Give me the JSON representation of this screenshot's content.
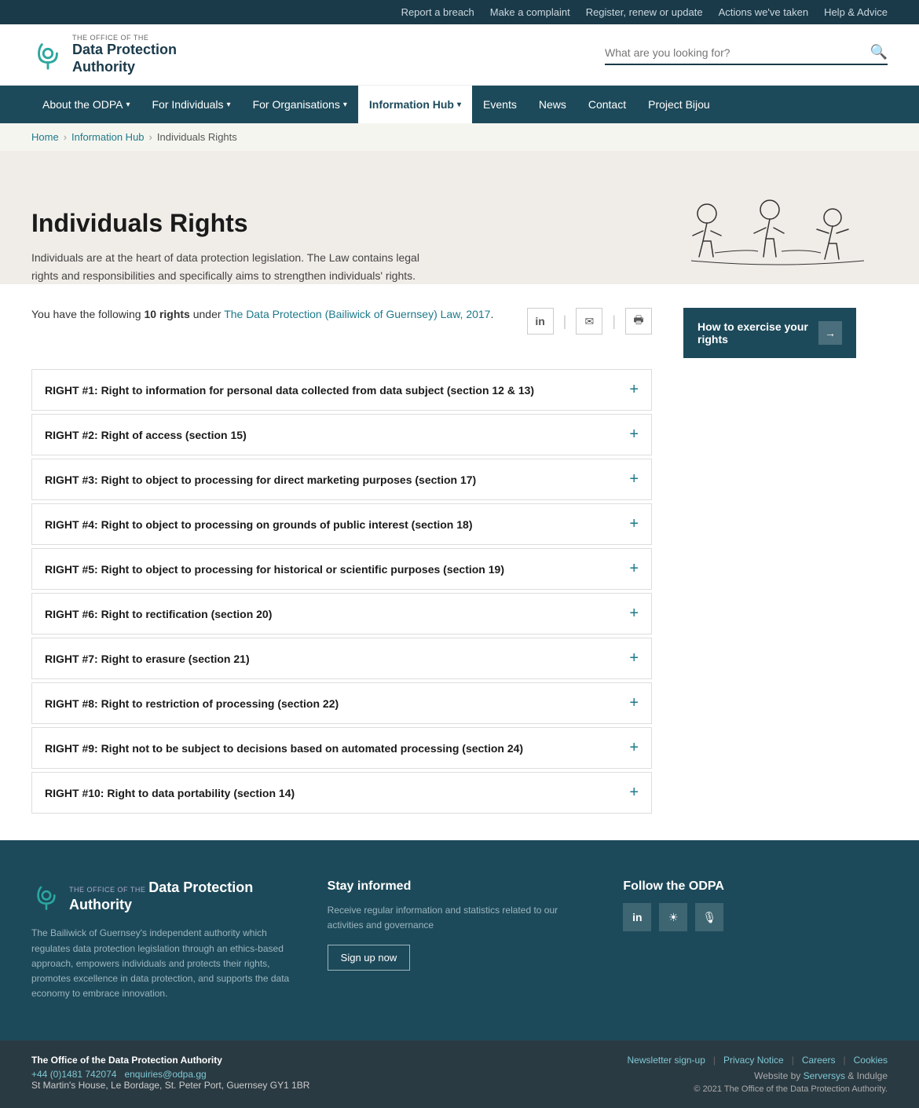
{
  "utility_bar": {
    "links": [
      {
        "id": "report-breach",
        "label": "Report a breach"
      },
      {
        "id": "make-complaint",
        "label": "Make a complaint"
      },
      {
        "id": "register-renew",
        "label": "Register, renew or update"
      },
      {
        "id": "actions-taken",
        "label": "Actions we've taken"
      },
      {
        "id": "help-advice",
        "label": "Help & Advice"
      }
    ]
  },
  "header": {
    "logo_the_office": "THE OFFICE OF THE",
    "logo_name_line1": "Data Protection",
    "logo_name_line2": "Authority",
    "search_placeholder": "What are you looking for?"
  },
  "nav": {
    "items": [
      {
        "id": "about-odpa",
        "label": "About the ODPA",
        "has_dropdown": true
      },
      {
        "id": "for-individuals",
        "label": "For Individuals",
        "has_dropdown": true
      },
      {
        "id": "for-organisations",
        "label": "For Organisations",
        "has_dropdown": true
      },
      {
        "id": "information-hub",
        "label": "Information Hub",
        "has_dropdown": true,
        "active": true
      },
      {
        "id": "events",
        "label": "Events",
        "has_dropdown": false
      },
      {
        "id": "news",
        "label": "News",
        "has_dropdown": false
      },
      {
        "id": "contact",
        "label": "Contact",
        "has_dropdown": false
      },
      {
        "id": "project-bijou",
        "label": "Project Bijou",
        "has_dropdown": false
      }
    ]
  },
  "breadcrumb": {
    "items": [
      {
        "id": "home",
        "label": "Home",
        "link": true
      },
      {
        "id": "information-hub",
        "label": "Information Hub",
        "link": true
      },
      {
        "id": "individuals-rights",
        "label": "Individuals Rights",
        "link": false
      }
    ]
  },
  "hero": {
    "title": "Individuals Rights",
    "description": "Individuals are at the heart of data protection legislation. The Law contains legal rights and responsibilities and specifically aims to strengthen individuals' rights."
  },
  "main": {
    "intro_text_before": "You have the following ",
    "intro_bold": "10 rights",
    "intro_text_after": " under ",
    "intro_link": "The Data Protection (Bailiwick of Guernsey) Law, 2017",
    "intro_end": ".",
    "rights": [
      {
        "id": "right-1",
        "label": "RIGHT #1: Right to information for personal data collected from data subject (section 12 & 13)"
      },
      {
        "id": "right-2",
        "label": "RIGHT #2: Right of access (section 15)"
      },
      {
        "id": "right-3",
        "label": "RIGHT #3: Right to object to processing for direct marketing purposes (section 17)"
      },
      {
        "id": "right-4",
        "label": "RIGHT #4: Right to object to processing on grounds of public interest (section 18)"
      },
      {
        "id": "right-5",
        "label": "RIGHT #5: Right to object to processing for historical or scientific purposes (section 19)"
      },
      {
        "id": "right-6",
        "label": "RIGHT #6: Right to rectification (section 20)"
      },
      {
        "id": "right-7",
        "label": "RIGHT #7: Right to erasure (section 21)"
      },
      {
        "id": "right-8",
        "label": "RIGHT #8: Right to restriction of processing (section 22)"
      },
      {
        "id": "right-9",
        "label": "RIGHT #9: Right not to be subject to decisions based on automated processing (section 24)"
      },
      {
        "id": "right-10",
        "label": "RIGHT #10: Right to data portability (section 14)"
      }
    ],
    "sidebar_cta": "How to exercise your rights"
  },
  "footer": {
    "logo_the_office": "THE OFFICE OF THE",
    "logo_name_line1": "Data Protection",
    "logo_name_line2": "Authority",
    "description": "The Bailiwick of Guernsey's independent authority which regulates data protection legislation through an ethics-based approach, empowers individuals and protects their rights, promotes excellence in data protection, and supports the data economy to embrace innovation.",
    "stay_informed_title": "Stay informed",
    "stay_informed_text": "Receive regular information and statistics related to our activities and governance",
    "sign_up_label": "Sign up now",
    "follow_title": "Follow the ODPA",
    "social_icons": [
      {
        "id": "linkedin",
        "symbol": "in"
      },
      {
        "id": "soundcloud",
        "symbol": "☁"
      },
      {
        "id": "podcast",
        "symbol": "🎙"
      }
    ],
    "bottom": {
      "org_name": "The Office of the Data Protection Authority",
      "phone": "+44 (0)1481 742074",
      "email": "enquiries@odpa.gg",
      "address": "St Martin's House, Le Bordage, St. Peter Port, Guernsey GY1 1BR",
      "links": [
        {
          "id": "newsletter-signup",
          "label": "Newsletter sign-up"
        },
        {
          "id": "privacy-notice",
          "label": "Privacy Notice"
        },
        {
          "id": "careers",
          "label": "Careers"
        },
        {
          "id": "cookies",
          "label": "Cookies"
        }
      ],
      "website_by": "Website by",
      "serversys": "Serversys",
      "and": "& Indulge",
      "copyright": "© 2021 The Office of the Data Protection Authority."
    }
  }
}
